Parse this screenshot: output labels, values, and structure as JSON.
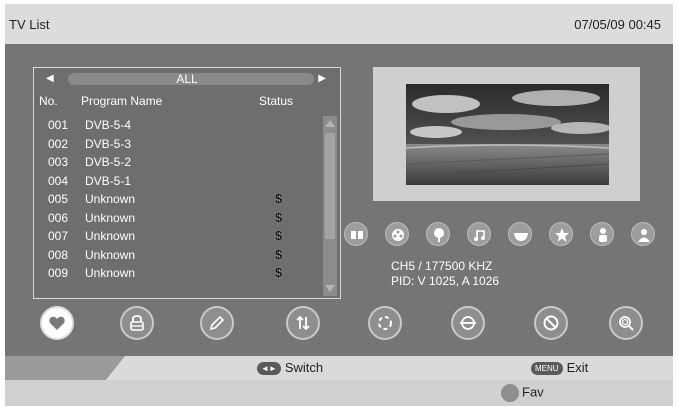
{
  "header": {
    "title": "TV List",
    "datetime": "07/05/09 00:45"
  },
  "list": {
    "group": "ALL",
    "columns": {
      "no": "No.",
      "name": "Program Name",
      "status": "Status"
    },
    "rows": [
      {
        "no": "001",
        "name": "DVB-5-4",
        "status": ""
      },
      {
        "no": "002",
        "name": "DVB-5-3",
        "status": ""
      },
      {
        "no": "003",
        "name": "DVB-5-2",
        "status": ""
      },
      {
        "no": "004",
        "name": "DVB-5-1",
        "status": ""
      },
      {
        "no": "005",
        "name": "Unknown",
        "status": "$"
      },
      {
        "no": "006",
        "name": "Unknown",
        "status": "$"
      },
      {
        "no": "007",
        "name": "Unknown",
        "status": "$"
      },
      {
        "no": "008",
        "name": "Unknown",
        "status": "$"
      },
      {
        "no": "009",
        "name": "Unknown",
        "status": "$"
      }
    ]
  },
  "channel_info": {
    "line1": "CH5 / 177500  KHZ",
    "line2": "PID: V 1025, A 1026"
  },
  "category_icons": [
    "book-icon",
    "film-reel-icon",
    "tree-icon",
    "music-icon",
    "bowl-icon",
    "star-icon",
    "person-icon",
    "user-icon"
  ],
  "function_icons": [
    "favorite-heart-icon",
    "lock-icon",
    "edit-pencil-icon",
    "sort-icon",
    "move-icon",
    "skip-icon",
    "delete-icon",
    "find-icon"
  ],
  "help": {
    "switch_key": "◄►",
    "switch_label": "Switch",
    "menu_key": "MENU",
    "exit_label": "Exit",
    "fav_label": "Fav"
  },
  "colors": {
    "background": "#757575",
    "header": "#dcdcdc",
    "panel_border": "#d8d8d8"
  }
}
